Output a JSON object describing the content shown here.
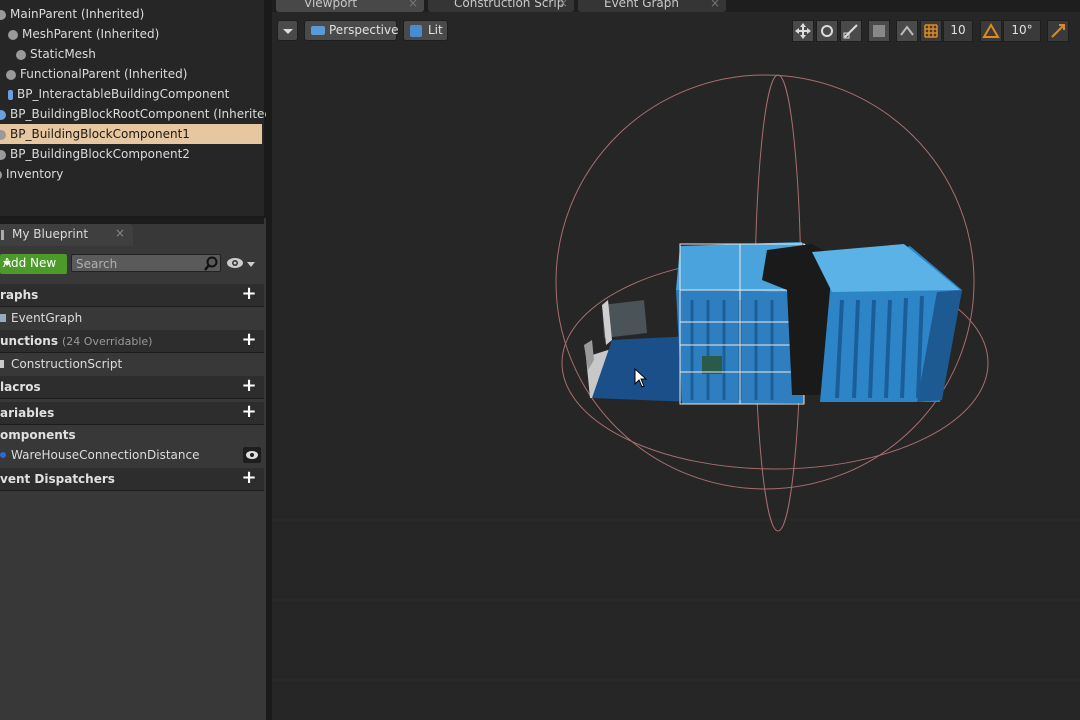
{
  "components_tree": {
    "items": [
      {
        "label": "MainParent (Inherited)",
        "selected": false
      },
      {
        "label": "MeshParent (Inherited)",
        "selected": false
      },
      {
        "label": "StaticMesh",
        "selected": false
      },
      {
        "label": "FunctionalParent (Inherited)",
        "selected": false
      },
      {
        "label": "BP_InteractableBuildingComponent",
        "selected": false
      },
      {
        "label": "BP_BuildingBlockRootComponent (Inherited)",
        "selected": false
      },
      {
        "label": "BP_BuildingBlockComponent1",
        "selected": true
      },
      {
        "label": "BP_BuildingBlockComponent2",
        "selected": false
      },
      {
        "label": "Inventory",
        "selected": false
      }
    ]
  },
  "my_blueprint": {
    "tab_label": "My Blueprint",
    "tab_close": "×",
    "add_new_label": "Add New",
    "search_placeholder": "Search",
    "sections": {
      "graphs": "raphs",
      "graphs_item": "EventGraph",
      "functions": "unctions",
      "functions_sub": "(24 Overridable)",
      "functions_item": "ConstructionScript",
      "macros": "lacros",
      "variables": "ariables",
      "components": "omponents",
      "components_item": "WareHouseConnectionDistance",
      "event_dispatchers": "vent Dispatchers"
    },
    "plus": "+"
  },
  "viewport": {
    "tabs": [
      {
        "label": "Viewport",
        "icon": "viewport-icon"
      },
      {
        "label": "Construction Scrip",
        "icon": "function-icon"
      },
      {
        "label": "Event Graph",
        "icon": "graph-icon"
      }
    ],
    "tab_close": "×",
    "perspective_label": "Perspective",
    "lit_label": "Lit",
    "grid_snap_value": "10",
    "rotation_snap_value": "10°"
  },
  "colors": {
    "selection": "#e7c79f",
    "add_new_green": "#4c9a2a",
    "container_blue": "#4aa3dc",
    "gizmo_ring": "#b07878"
  }
}
